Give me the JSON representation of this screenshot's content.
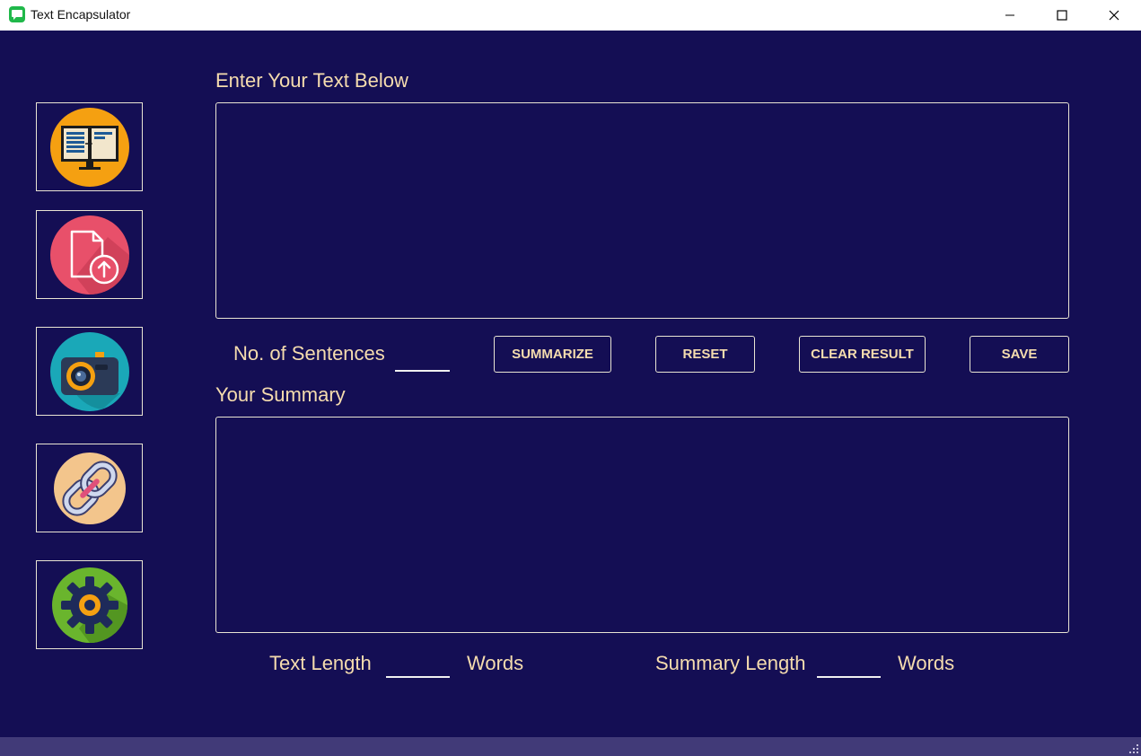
{
  "window": {
    "title": "Text Encapsulator",
    "app_icon": "chat-bubble-icon",
    "controls": [
      "minimize-icon",
      "maximize-icon",
      "close-icon"
    ]
  },
  "sidebar": {
    "items": [
      {
        "name": "text-input-mode",
        "icon": "monitor-document-icon"
      },
      {
        "name": "upload-file-mode",
        "icon": "file-upload-icon"
      },
      {
        "name": "camera-mode",
        "icon": "camera-icon"
      },
      {
        "name": "url-link-mode",
        "icon": "chain-link-icon"
      },
      {
        "name": "settings",
        "icon": "gear-icon"
      }
    ]
  },
  "main": {
    "input_heading": "Enter Your Text Below",
    "input_value": "",
    "sentences_label": "No. of Sentences",
    "sentences_value": "",
    "buttons": {
      "summarize": "SUMMARIZE",
      "reset": "RESET",
      "clear_result": "CLEAR RESULT",
      "save": "SAVE"
    },
    "summary_heading": "Your Summary",
    "summary_value": "",
    "text_length_label": "Text Length",
    "text_length_value": "",
    "text_length_unit": "Words",
    "summary_length_label": "Summary Length",
    "summary_length_value": "",
    "summary_length_unit": "Words"
  },
  "colors": {
    "background": "#140e54",
    "text": "#f5dcae",
    "border": "#e9e4d3",
    "statusbar": "#413a78"
  }
}
